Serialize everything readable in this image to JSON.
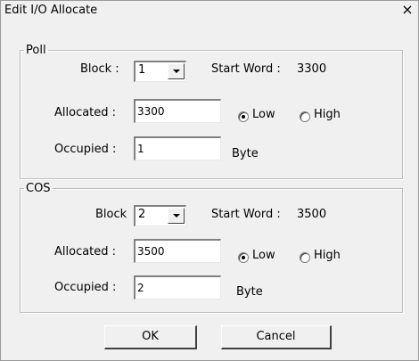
{
  "window": {
    "title": "Edit I/O Allocate",
    "close_glyph": "×"
  },
  "poll": {
    "legend": "Poll",
    "block_label": "Block :",
    "block_value": "1",
    "start_word_label": "Start Word :",
    "start_word_value": "3300",
    "allocated_label": "Allocated :",
    "allocated_value": "3300",
    "low_label": "Low",
    "high_label": "High",
    "selected": "Low",
    "occupied_label": "Occupied :",
    "occupied_value": "1",
    "unit_label": "Byte"
  },
  "cos": {
    "legend": "COS",
    "block_label": "Block",
    "block_value": "2",
    "start_word_label": "Start Word :",
    "start_word_value": "3500",
    "allocated_label": "Allocated :",
    "allocated_value": "3500",
    "low_label": "Low",
    "high_label": "High",
    "selected": "Low",
    "occupied_label": "Occupied :",
    "occupied_value": "2",
    "unit_label": "Byte"
  },
  "buttons": {
    "ok": "OK",
    "cancel": "Cancel"
  }
}
